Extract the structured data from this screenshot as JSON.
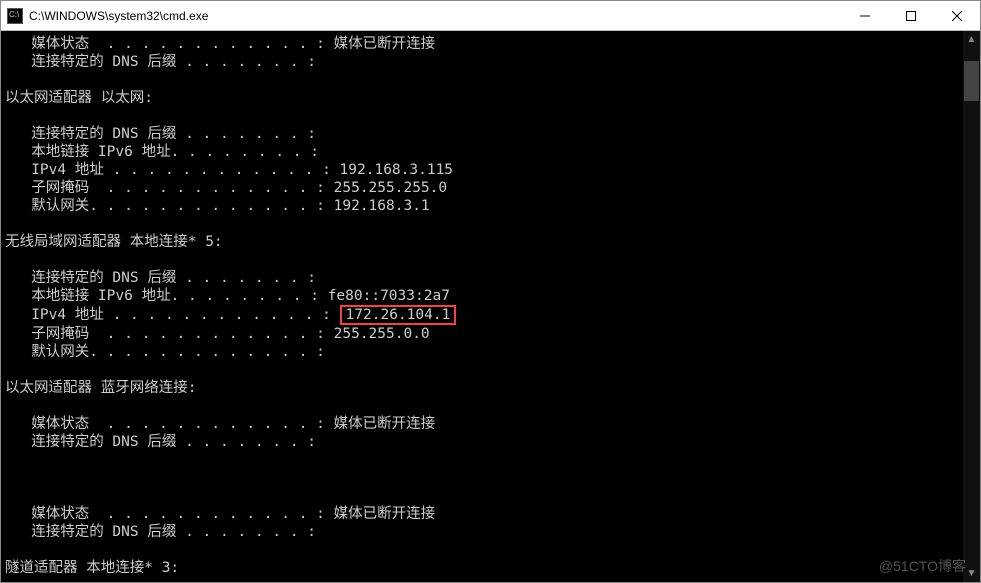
{
  "window": {
    "title": "C:\\WINDOWS\\system32\\cmd.exe"
  },
  "watermark": "@51CTO博客",
  "highlight": {
    "ip": "172.26.104.1"
  },
  "terminal": {
    "lines": [
      "   媒体状态  . . . . . . . . . . . . : 媒体已断开连接",
      "   连接特定的 DNS 后缀 . . . . . . . :",
      "",
      "以太网适配器 以太网:",
      "",
      "   连接特定的 DNS 后缀 . . . . . . . :",
      "   本地链接 IPv6 地址. . . . . . . . :",
      "   IPv4 地址 . . . . . . . . . . . . : 192.168.3.115",
      "   子网掩码  . . . . . . . . . . . . : 255.255.255.0",
      "   默认网关. . . . . . . . . . . . . : 192.168.3.1",
      "",
      "无线局域网适配器 本地连接* 5:",
      "",
      "   连接特定的 DNS 后缀 . . . . . . . :",
      "   本地链接 IPv6 地址. . . . . . . . : fe80::7033:2a7",
      "   IPv4 地址 . . . . . . . . . . . . : {{HL}}",
      "   子网掩码  . . . . . . . . . . . . : 255.255.0.0",
      "   默认网关. . . . . . . . . . . . . :",
      "",
      "以太网适配器 蓝牙网络连接:",
      "",
      "   媒体状态  . . . . . . . . . . . . : 媒体已断开连接",
      "   连接特定的 DNS 后缀 . . . . . . . :",
      "",
      "",
      "",
      "   媒体状态  . . . . . . . . . . . . : 媒体已断开连接",
      "   连接特定的 DNS 后缀 . . . . . . . :",
      "",
      "隧道适配器 本地连接* 3:"
    ]
  }
}
